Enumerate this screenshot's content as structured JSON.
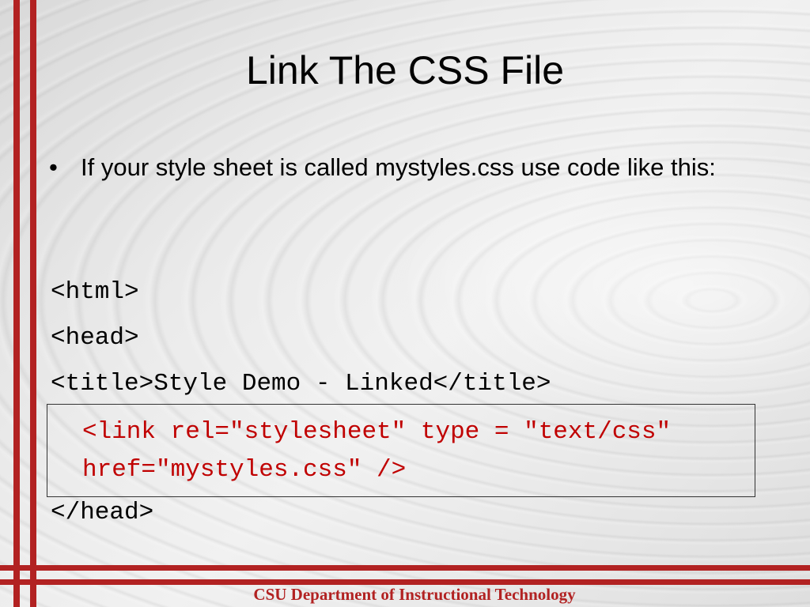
{
  "slide": {
    "title": "Link The CSS File",
    "bullet_symbol": "•",
    "bullet_text": "If your style sheet is called mystyles.css use code like this:",
    "code_lines": {
      "html_open": "<html>",
      "head_open": "<head>",
      "title_line": "<title>Style Demo - Linked</title>",
      "link_line": "<link rel=\"stylesheet\" type = \"text/css\" href=\"mystyles.css\" />",
      "head_close": "</head>"
    },
    "footer": "CSU Department of Instructional Technology"
  },
  "colors": {
    "accent_red": "#b22222",
    "code_highlight_red": "#c00000"
  }
}
